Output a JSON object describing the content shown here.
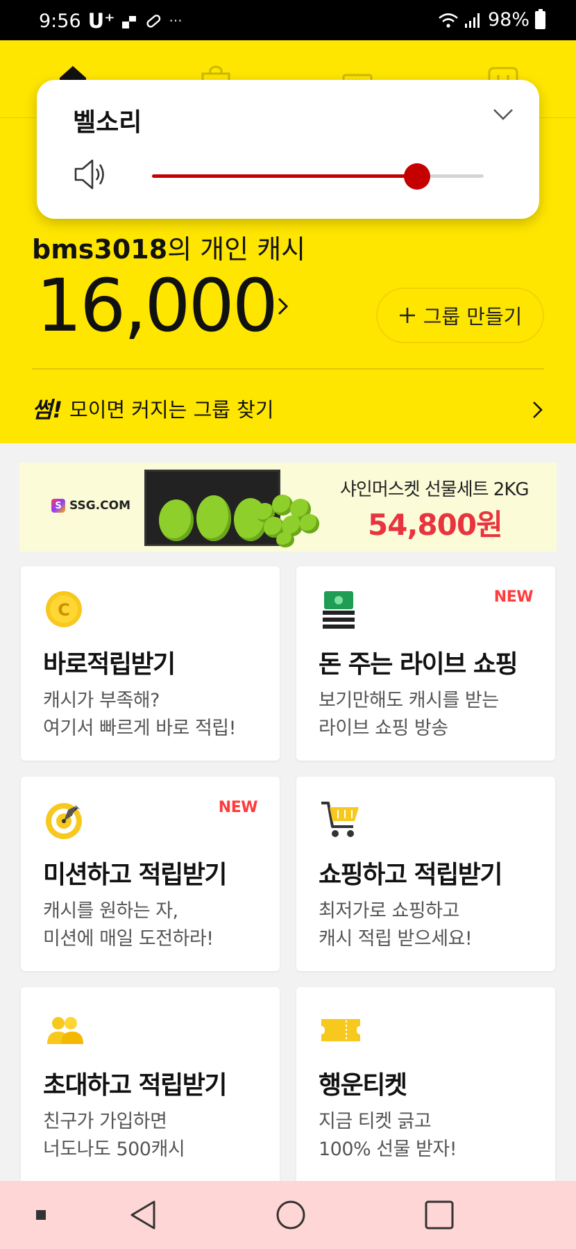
{
  "status_bar": {
    "time": "9:56",
    "carrier": "U⁺",
    "more": "···",
    "battery": "98%"
  },
  "volume_popup": {
    "title": "벨소리",
    "level": 0.8
  },
  "account": {
    "user": "bms3018",
    "suffix": "의 개인 캐시",
    "amount": "16,000",
    "group_button": "그룹 만들기"
  },
  "find_group": {
    "brand": "썸!",
    "text": "모이면 커지는 그룹 찾기"
  },
  "banner": {
    "logo": "SSG.COM",
    "caption": "샤인머스켓 선물세트 2KG",
    "price": "54,800원"
  },
  "cards": [
    {
      "title": "바로적립받기",
      "line1": "캐시가 부족해?",
      "line2": "여기서 빠르게 바로 적립!",
      "badge": ""
    },
    {
      "title": "돈 주는 라이브 쇼핑",
      "line1": "보기만해도 캐시를 받는",
      "line2": "라이브 쇼핑 방송",
      "badge": "NEW"
    },
    {
      "title": "미션하고 적립받기",
      "line1": "캐시를 원하는 자,",
      "line2": "미션에 매일 도전하라!",
      "badge": "NEW"
    },
    {
      "title": "쇼핑하고 적립받기",
      "line1": "최저가로 쇼핑하고",
      "line2": "캐시 적립 받으세요!",
      "badge": ""
    },
    {
      "title": "초대하고 적립받기",
      "line1": "친구가 가입하면",
      "line2": "너도나도 500캐시",
      "badge": ""
    },
    {
      "title": "행운티켓",
      "line1": "지금 티켓 긁고",
      "line2": "100% 선물 받자!",
      "badge": ""
    }
  ],
  "icons": {
    "coin": "coin-icon",
    "money": "money-icon",
    "target": "target-icon",
    "cart": "cart-icon",
    "people": "people-icon",
    "ticket": "ticket-icon"
  },
  "colors": {
    "header_yellow": "#ffe600",
    "slider_red": "#c40000",
    "new_red": "#ff3b3b",
    "price_red": "#e8343e",
    "nav_pink": "#ffd6d6"
  }
}
